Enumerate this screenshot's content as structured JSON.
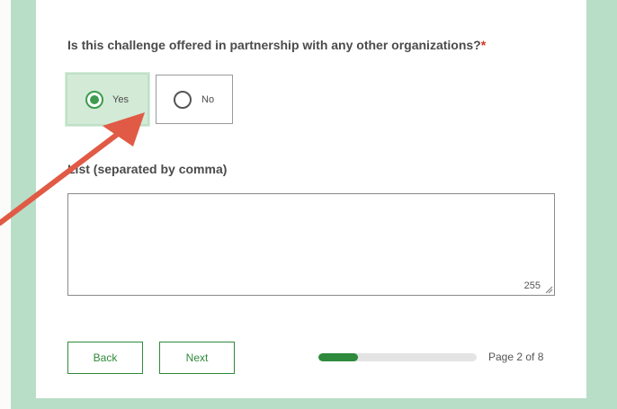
{
  "question": {
    "text": "Is this challenge offered in partnership with any other organizations?",
    "required_marker": "*"
  },
  "options": [
    {
      "label": "Yes",
      "selected": true
    },
    {
      "label": "No",
      "selected": false
    }
  ],
  "list_field": {
    "label": "List (separated by comma)",
    "value": "",
    "char_count": "255"
  },
  "navigation": {
    "back_label": "Back",
    "next_label": "Next"
  },
  "progress": {
    "current_page": 2,
    "total_pages": 8,
    "fraction": 0.25,
    "label": "Page 2 of 8"
  },
  "colors": {
    "accent_green": "#2e8a3c",
    "side_band": "#b9dec7",
    "selected_option_bg": "#d2ead6",
    "annotation_arrow": "#e05a45",
    "required_star": "#d83020"
  },
  "annotation": {
    "icon": "annotation-arrow-icon"
  }
}
